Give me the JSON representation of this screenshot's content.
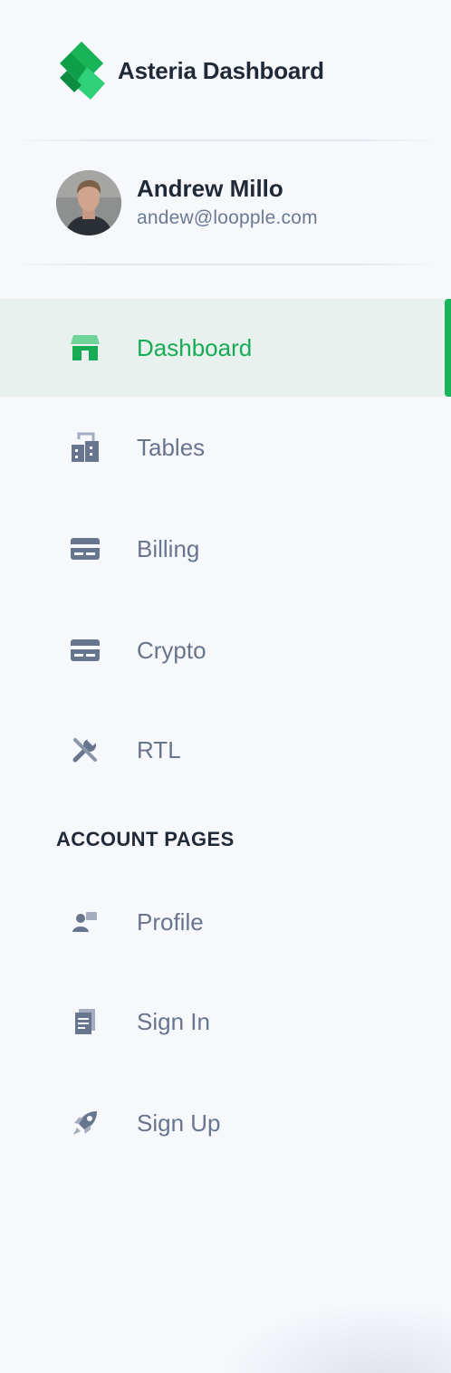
{
  "brand": {
    "name": "Asteria Dashboard",
    "logo_icon": "diamond-logo-icon",
    "accent": "#18b45a"
  },
  "user": {
    "name": "Andrew Millo",
    "email": "andew@loopple.com",
    "avatar_icon": "avatar-photo"
  },
  "nav": [
    {
      "label": "Dashboard",
      "icon": "shop-icon",
      "active": true
    },
    {
      "label": "Tables",
      "icon": "office-icon",
      "active": false
    },
    {
      "label": "Billing",
      "icon": "credit-card-icon",
      "active": false
    },
    {
      "label": "Crypto",
      "icon": "credit-card-icon",
      "active": false
    },
    {
      "label": "RTL",
      "icon": "settings-tools-icon",
      "active": false
    }
  ],
  "account_section": {
    "title": "ACCOUNT PAGES"
  },
  "account_nav": [
    {
      "label": "Profile",
      "icon": "customer-support-icon"
    },
    {
      "label": "Sign In",
      "icon": "document-icon"
    },
    {
      "label": "Sign Up",
      "icon": "rocket-icon"
    }
  ],
  "colors": {
    "background": "#f6f8fc",
    "text_muted": "#68758e",
    "active_bg": "#e8f1ee",
    "active_text": "#17ab55"
  }
}
